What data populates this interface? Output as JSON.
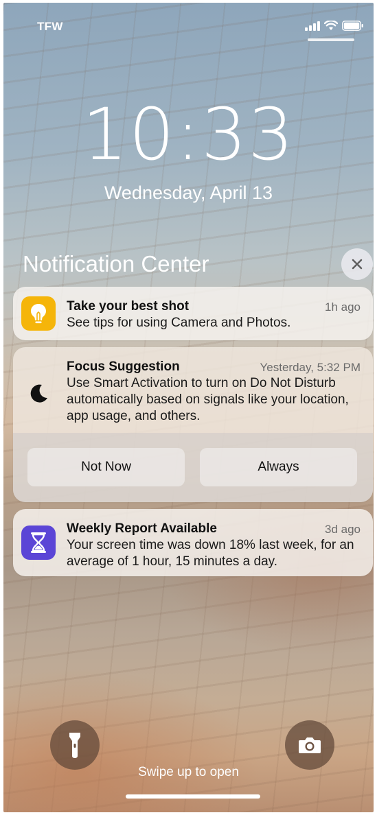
{
  "status_bar": {
    "carrier": "TFW"
  },
  "lock": {
    "time": "10:33",
    "date": "Wednesday, April 13"
  },
  "notification_center": {
    "title": "Notification Center"
  },
  "notifications": [
    {
      "app_icon": "lightbulb-icon",
      "title": "Take your best shot",
      "time": "1h ago",
      "body": "See tips for using Camera and Photos."
    },
    {
      "app_icon": "moon-icon",
      "title": "Focus Suggestion",
      "time": "Yesterday, 5:32 PM",
      "body": "Use Smart Activation to turn on Do Not Disturb automatically based on signals like your location, app usage, and others.",
      "actions": [
        "Not Now",
        "Always"
      ]
    },
    {
      "app_icon": "hourglass-icon",
      "title": "Weekly Report Available",
      "time": "3d ago",
      "body": "Your screen time was down 18% last week, for an average of 1 hour, 15 minutes a day."
    }
  ],
  "bottom": {
    "swipe_hint": "Swipe up to open"
  },
  "colors": {
    "tips_icon": "#f5b50a",
    "screentime_icon": "#5b45d6"
  }
}
